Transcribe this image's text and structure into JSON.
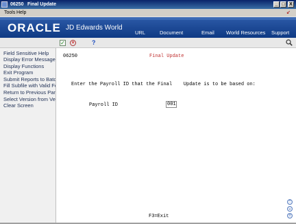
{
  "window": {
    "code": "06250",
    "title": "Final Update",
    "minimize": "_",
    "maximize": "□",
    "close": "X"
  },
  "menu": {
    "tools": "Tools",
    "help": "Help"
  },
  "banner": {
    "oracle": "ORACLE",
    "product": "JD Edwards World",
    "nav": [
      "URL",
      "Document",
      "Email",
      "World Resources",
      "Support"
    ]
  },
  "exits": [
    "Field Sensitive Help",
    "Display Error Message",
    "Display Functions",
    "Exit Program",
    "Submit Reports to Batch",
    "Fill Subfile with Valid For",
    "Return to Previous Pane",
    "Select Version from Ver",
    "Clear Screen"
  ],
  "form": {
    "id": "06250",
    "title": "Final Update",
    "prompt": "Enter the Payroll ID that the Final    Update is to be based on:",
    "payroll_label": "Payroll ID",
    "payroll_value": "001",
    "function_keys": "F3=Exit"
  },
  "colors": {
    "banner": "#1a4690",
    "title_red": "#c03030"
  }
}
